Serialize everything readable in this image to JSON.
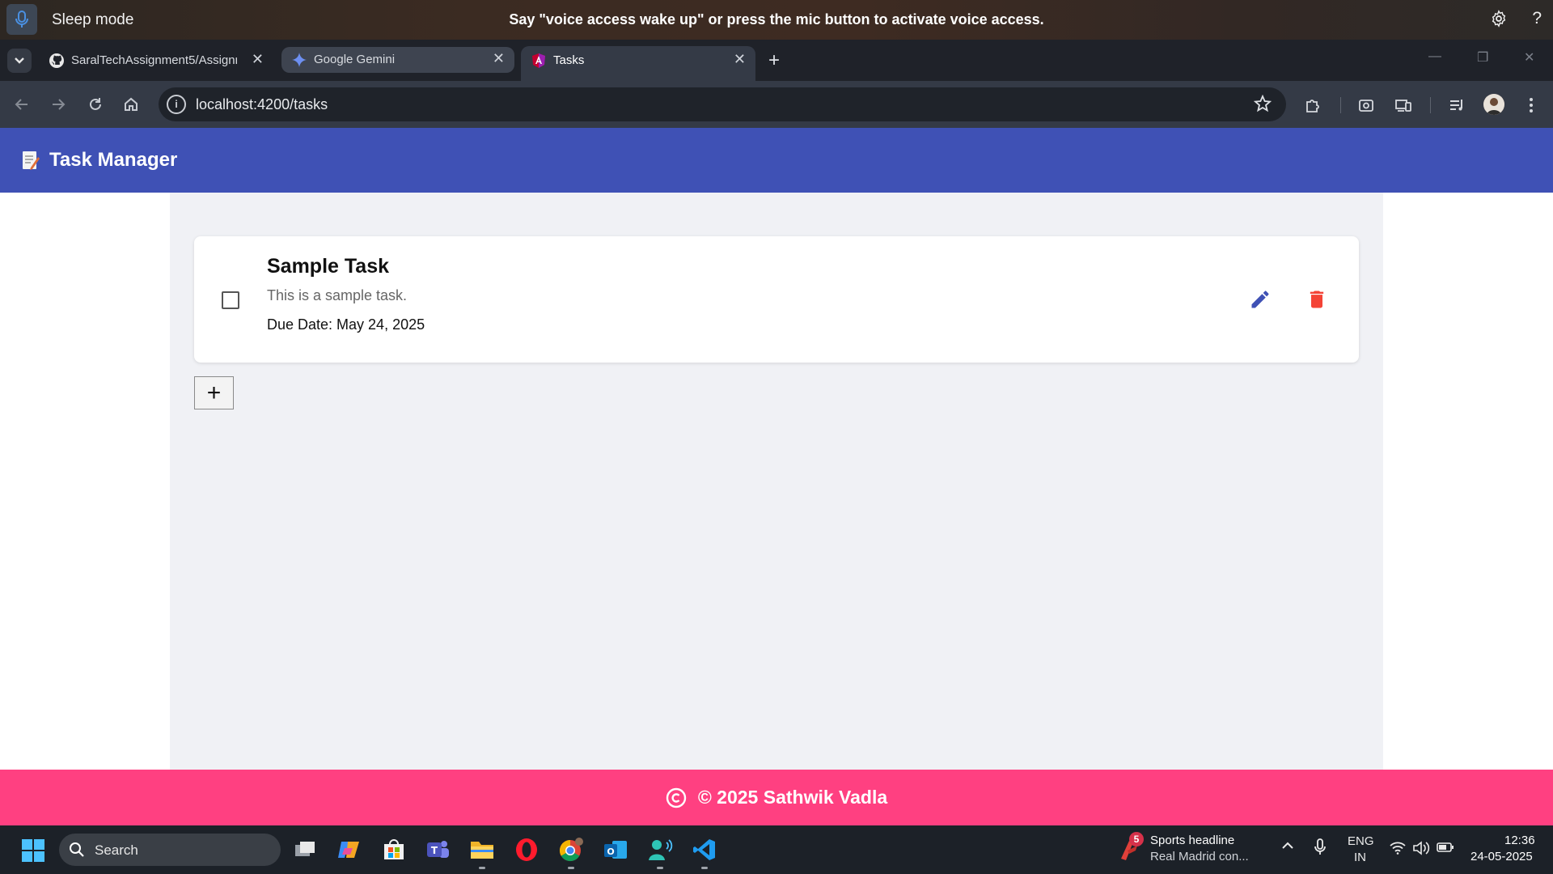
{
  "voice_access": {
    "mode_label": "Sleep mode",
    "message": "Say \"voice access wake up\" or press the mic button to activate voice access.",
    "help_label": "?"
  },
  "browser": {
    "tabs": [
      {
        "title": "SaralTechAssignment5/Assignm",
        "favicon": "github-icon",
        "active": false
      },
      {
        "title": "Google Gemini",
        "favicon": "gemini-icon",
        "active": false
      },
      {
        "title": "Tasks",
        "favicon": "angular-icon",
        "active": true
      }
    ],
    "url": "localhost:4200/tasks",
    "info_glyph": "i"
  },
  "app": {
    "title": "Task Manager",
    "logo_icon": "memo-icon",
    "header_color": "#3f51b5",
    "tasks": [
      {
        "title": "Sample Task",
        "description": "This is a sample task.",
        "due_label": "Due Date: May 24, 2025",
        "completed": false
      }
    ],
    "add_button_label": "+",
    "footer_text": "© 2025 Sathwik Vadla",
    "footer_color": "#ff4081",
    "edit_color": "#3f51b5",
    "delete_color": "#f44336"
  },
  "taskbar": {
    "search_label": "Search",
    "news_badge": "5",
    "news_headline": "Sports headline",
    "news_sub": "Real Madrid con...",
    "lang_line1": "ENG",
    "lang_line2": "IN",
    "time": "12:36",
    "date": "24-05-2025"
  }
}
